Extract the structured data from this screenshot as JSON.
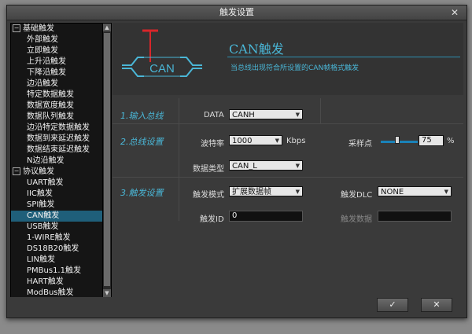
{
  "window": {
    "title": "触发设置",
    "close": "✕"
  },
  "tree": {
    "items": [
      {
        "label": "基础触发",
        "level": 0,
        "expander": "−"
      },
      {
        "label": "外部触发",
        "level": 1
      },
      {
        "label": "立即触发",
        "level": 1
      },
      {
        "label": "上升沿触发",
        "level": 1
      },
      {
        "label": "下降沿触发",
        "level": 1
      },
      {
        "label": "边沿触发",
        "level": 1
      },
      {
        "label": "特定数据触发",
        "level": 1
      },
      {
        "label": "数据宽度触发",
        "level": 1
      },
      {
        "label": "数据队列触发",
        "level": 1
      },
      {
        "label": "边沿特定数据触发",
        "level": 1
      },
      {
        "label": "数据到来延迟触发",
        "level": 1
      },
      {
        "label": "数据结束延迟触发",
        "level": 1
      },
      {
        "label": "N边沿触发",
        "level": 1
      },
      {
        "label": "协议触发",
        "level": 0,
        "expander": "−"
      },
      {
        "label": "UART触发",
        "level": 1
      },
      {
        "label": "IIC触发",
        "level": 1
      },
      {
        "label": "SPI触发",
        "level": 1
      },
      {
        "label": "CAN触发",
        "level": 1,
        "selected": true
      },
      {
        "label": "USB触发",
        "level": 1
      },
      {
        "label": "1-WIRE触发",
        "level": 1
      },
      {
        "label": "DS18B20触发",
        "level": 1
      },
      {
        "label": "LIN触发",
        "level": 1
      },
      {
        "label": "PMBus1.1触发",
        "level": 1
      },
      {
        "label": "HART触发",
        "level": 1
      },
      {
        "label": "ModBus触发",
        "level": 1
      }
    ]
  },
  "header": {
    "logo_text": "CAN",
    "title": "CAN触发",
    "description": "当总线出现符合所设置的CAN帧格式触发"
  },
  "sections": {
    "input": "1.输入总线",
    "bus": "2.总线设置",
    "trigger": "3.触发设置"
  },
  "fields": {
    "data_label": "DATA",
    "data_value": "CANH",
    "baud_label": "波特率",
    "baud_value": "1000",
    "baud_unit": "Kbps",
    "sample_label": "采样点",
    "sample_value": "75",
    "sample_unit": "%",
    "sample_fraction": 0.75,
    "datatype_label": "数据类型",
    "datatype_value": "CAN_L",
    "mode_label": "触发模式",
    "mode_value": "扩展数据帧",
    "dlc_label": "触发DLC",
    "dlc_value": "NONE",
    "id_label": "触发ID",
    "id_value": "0",
    "tdata_label": "触发数据",
    "tdata_value": ""
  },
  "buttons": {
    "ok": "✓",
    "cancel": "✕"
  },
  "colors": {
    "accent": "#4ab6d6",
    "selection": "#1f5f7a",
    "logo_red": "#d8262a"
  }
}
